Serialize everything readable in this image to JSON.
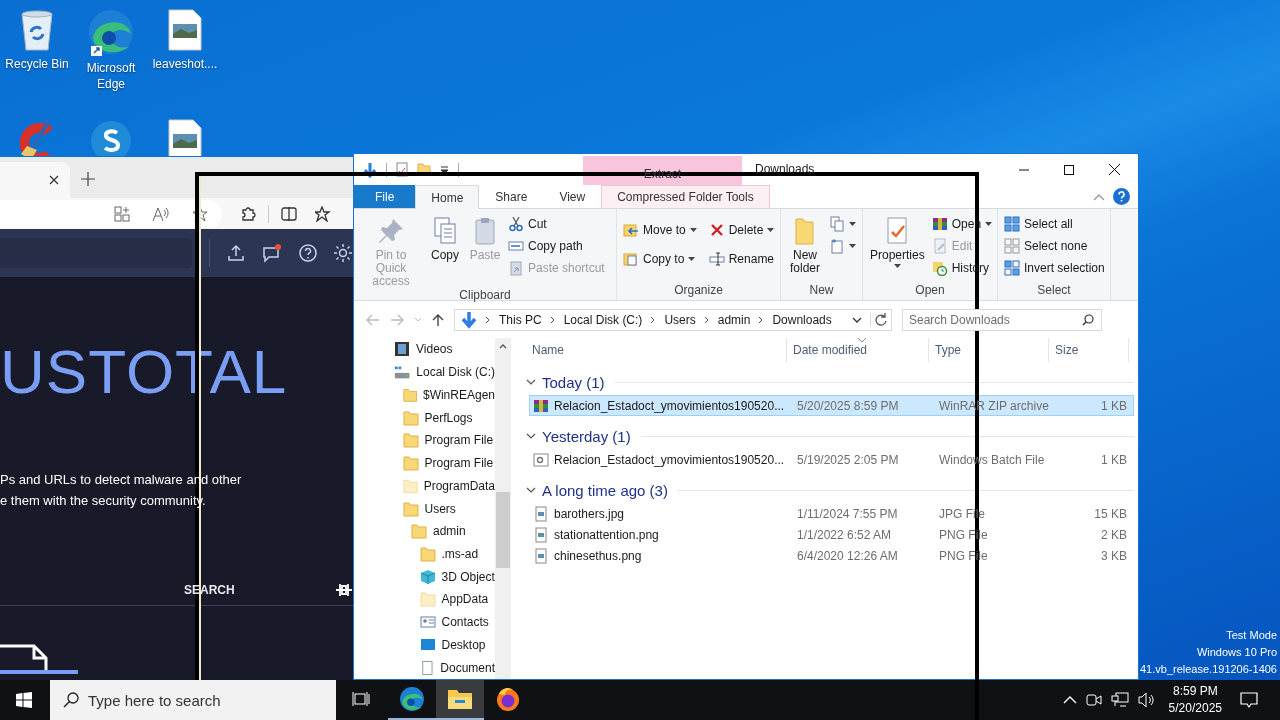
{
  "desktop": {
    "icons": [
      {
        "kind": "recycle",
        "label": "Recycle Bin"
      },
      {
        "kind": "edge",
        "label": "Microsoft Edge"
      },
      {
        "kind": "image",
        "label": "leaveshot...."
      },
      {
        "kind": "cleaner"
      },
      {
        "kind": "skype"
      },
      {
        "kind": "image"
      }
    ],
    "system_notice": [
      "Test Mode",
      "Windows 10 Pro",
      "41.vb_release.191206-1406"
    ]
  },
  "browser": {
    "notification_dot": true,
    "hero_title": "USTOTAL",
    "description": [
      "Ps and URLs to detect malware and other",
      "e them with the security community."
    ],
    "search_tab": "SEARCH"
  },
  "explorer": {
    "context_tab_title": "Extract",
    "title": "Downloads",
    "tabs": [
      {
        "label": "File",
        "kind": "file",
        "selected": false
      },
      {
        "label": "Home",
        "kind": "normal",
        "selected": true
      },
      {
        "label": "Share",
        "kind": "normal",
        "selected": false
      },
      {
        "label": "View",
        "kind": "normal",
        "selected": false
      },
      {
        "label": "Compressed Folder Tools",
        "kind": "context",
        "selected": false
      }
    ],
    "ribbon": [
      {
        "label": "Clipboard",
        "commands": [
          {
            "label": "Pin to Quick access",
            "kind": "large",
            "disabled": true,
            "menu": false
          },
          {
            "label": "Copy",
            "kind": "large",
            "disabled": false,
            "menu": false
          },
          {
            "label": "Paste",
            "kind": "large",
            "disabled": true,
            "menu": false
          },
          {
            "label": "Cut",
            "kind": "small",
            "disabled": false,
            "menu": false
          },
          {
            "label": "Copy path",
            "kind": "small",
            "disabled": false,
            "menu": false
          },
          {
            "label": "Paste shortcut",
            "kind": "small",
            "disabled": true,
            "menu": false
          }
        ]
      },
      {
        "label": "Organize",
        "commands": [
          {
            "label": "Move to",
            "kind": "small",
            "disabled": false,
            "menu": true
          },
          {
            "label": "Copy to",
            "kind": "small",
            "disabled": false,
            "menu": true
          },
          {
            "label": "Delete",
            "kind": "small",
            "disabled": false,
            "menu": true
          },
          {
            "label": "Rename",
            "kind": "small",
            "disabled": false,
            "menu": false
          }
        ]
      },
      {
        "label": "New",
        "commands": [
          {
            "label": "New folder",
            "kind": "large",
            "disabled": false,
            "menu": false
          },
          {
            "kind": "small",
            "disabled": false,
            "menu": true
          },
          {
            "kind": "small",
            "disabled": false,
            "menu": true
          }
        ]
      },
      {
        "label": "Open",
        "commands": [
          {
            "label": "Properties",
            "kind": "large",
            "disabled": false,
            "menu": true
          },
          {
            "label": "Open",
            "kind": "small",
            "disabled": false,
            "menu": true
          },
          {
            "label": "Edit",
            "kind": "small",
            "disabled": true,
            "menu": false
          },
          {
            "label": "History",
            "kind": "small",
            "disabled": false,
            "menu": false
          }
        ]
      },
      {
        "label": "Select",
        "commands": [
          {
            "label": "Select all",
            "kind": "small",
            "disabled": false,
            "menu": false
          },
          {
            "label": "Select none",
            "kind": "small",
            "disabled": false,
            "menu": false
          },
          {
            "label": "Invert selection",
            "kind": "small",
            "disabled": false,
            "menu": false
          }
        ]
      }
    ],
    "address": {
      "parts": [
        "This PC",
        "Local Disk (C:)",
        "Users",
        "admin",
        "Downloads"
      ],
      "search_placeholder": "Search Downloads"
    },
    "nav_tree": [
      {
        "label": "Videos",
        "kind": "videos"
      },
      {
        "label": "Local Disk (C:)",
        "kind": "drive",
        "children": [
          {
            "label": "$WinREAgen",
            "kind": "folder",
            "hidden": false
          },
          {
            "label": "PerfLogs",
            "kind": "folder",
            "hidden": false
          },
          {
            "label": "Program File",
            "kind": "folder",
            "hidden": false
          },
          {
            "label": "Program File",
            "kind": "folder",
            "hidden": false
          },
          {
            "label": "ProgramData",
            "kind": "folder",
            "hidden": true
          },
          {
            "label": "Users",
            "kind": "folder",
            "hidden": false,
            "children": [
              {
                "label": "admin",
                "kind": "folder",
                "hidden": false,
                "children": [
                  {
                    "label": ".ms-ad",
                    "kind": "folder",
                    "hidden": false
                  },
                  {
                    "label": "3D Object",
                    "kind": "objects"
                  },
                  {
                    "label": "AppData",
                    "kind": "folder",
                    "hidden": true
                  },
                  {
                    "label": "Contacts",
                    "kind": "contacts"
                  },
                  {
                    "label": "Desktop",
                    "kind": "desktop"
                  },
                  {
                    "label": "Document",
                    "kind": "documents"
                  }
                ]
              }
            ]
          }
        ]
      }
    ],
    "columns": [
      {
        "label": "Name",
        "sorted": false
      },
      {
        "label": "Date modified",
        "sorted": true
      },
      {
        "label": "Type",
        "sorted": false
      },
      {
        "label": "Size",
        "sorted": false
      }
    ],
    "groups": [
      {
        "label": "Today (1)",
        "expanded": true,
        "files": [
          {
            "name": "Relacion_Estadoct_ymovimientos190520...",
            "date": "5/20/2025 8:59 PM",
            "type": "WinRAR ZIP archive",
            "size": "1 KB",
            "kind": "archive",
            "selected": true
          }
        ]
      },
      {
        "label": "Yesterday (1)",
        "expanded": true,
        "files": [
          {
            "name": "Relacion_Estadoct_ymovimientos190520...",
            "date": "5/19/2025 2:05 PM",
            "type": "Windows Batch File",
            "size": "1 KB",
            "kind": "batch",
            "selected": false
          }
        ]
      },
      {
        "label": "A long time ago (3)",
        "expanded": true,
        "files": [
          {
            "name": "barothers.jpg",
            "date": "1/11/2024 7:55 PM",
            "type": "JPG File",
            "size": "15 KB",
            "kind": "image",
            "selected": false
          },
          {
            "name": "stationattention.png",
            "date": "1/1/2022 6:52 AM",
            "type": "PNG File",
            "size": "2 KB",
            "kind": "image",
            "selected": false
          },
          {
            "name": "chinesethus.png",
            "date": "6/4/2020 12:26 AM",
            "type": "PNG File",
            "size": "3 KB",
            "kind": "image",
            "selected": false
          }
        ]
      }
    ]
  },
  "taskbar": {
    "search_placeholder": "Type here to search",
    "apps": [
      {
        "kind": "edge",
        "running": true,
        "active": false
      },
      {
        "kind": "explorer",
        "running": true,
        "active": true
      },
      {
        "kind": "firefox",
        "running": false,
        "active": false
      }
    ],
    "time": "8:59 PM",
    "date": "5/20/2025"
  }
}
